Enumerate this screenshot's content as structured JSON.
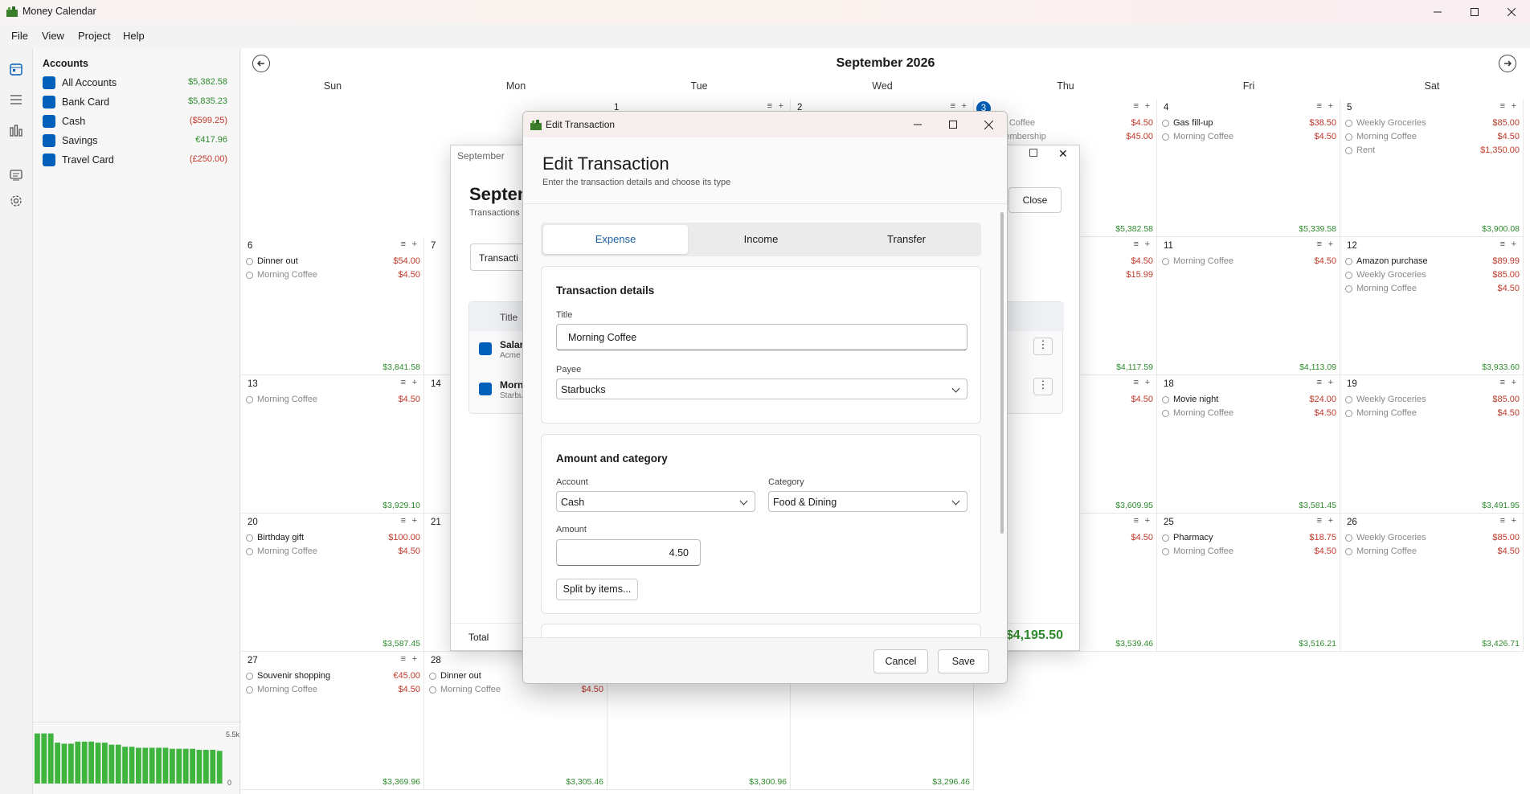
{
  "app": {
    "title": "Money Calendar"
  },
  "menu": [
    "File",
    "View",
    "Project",
    "Help"
  ],
  "accounts": {
    "heading": "Accounts",
    "items": [
      {
        "name": "All Accounts",
        "balance": "$5,382.58",
        "type": "pos"
      },
      {
        "name": "Bank Card",
        "balance": "$5,835.23",
        "type": "pos"
      },
      {
        "name": "Cash",
        "balance": "($599.25)",
        "type": "neg"
      },
      {
        "name": "Savings",
        "balance": "€417.96",
        "type": "pos"
      },
      {
        "name": "Travel Card",
        "balance": "(£250.00)",
        "type": "neg"
      }
    ]
  },
  "sparkline": {
    "max_label": "5.5k",
    "min_label": "0",
    "values": [
      4.9,
      4.9,
      4.9,
      4.0,
      3.9,
      3.9,
      4.1,
      4.1,
      4.1,
      4.0,
      4.0,
      3.8,
      3.8,
      3.6,
      3.6,
      3.5,
      3.5,
      3.5,
      3.5,
      3.5,
      3.4,
      3.4,
      3.4,
      3.4,
      3.3,
      3.3,
      3.3,
      3.2
    ]
  },
  "calendar": {
    "title": "September 2026",
    "days": [
      "Sun",
      "Mon",
      "Tue",
      "Wed",
      "Thu",
      "Fri",
      "Sat"
    ]
  },
  "cells": [
    {
      "day": "1",
      "col": 2,
      "row": 0,
      "total": ""
    },
    {
      "day": "2",
      "col": 3,
      "row": 0,
      "total": ""
    },
    {
      "day": "3",
      "col": 4,
      "row": 0,
      "today": true,
      "total": "$5,382.58",
      "tx": [
        {
          "t": "ning Coffee",
          "a": "$4.50",
          "rec": true
        },
        {
          "t": "n Membership",
          "a": "$45.00",
          "rec": true
        }
      ]
    },
    {
      "day": "4",
      "col": 5,
      "row": 0,
      "total": "$5,339.58",
      "tx": [
        {
          "t": "Gas fill-up",
          "a": "$38.50"
        },
        {
          "t": "Morning Coffee",
          "a": "$4.50",
          "rec": true
        }
      ]
    },
    {
      "day": "5",
      "col": 6,
      "row": 0,
      "total": "$3,900.08",
      "tx": [
        {
          "t": "Weekly Groceries",
          "a": "$85.00",
          "rec": true
        },
        {
          "t": "Morning Coffee",
          "a": "$4.50",
          "rec": true
        },
        {
          "t": "Rent",
          "a": "$1,350.00",
          "rec": true
        }
      ]
    },
    {
      "day": "6",
      "col": 0,
      "row": 1,
      "total": "$3,841.58",
      "tx": [
        {
          "t": "Dinner out",
          "a": "$54.00"
        },
        {
          "t": "Morning Coffee",
          "a": "$4.50",
          "rec": true
        }
      ]
    },
    {
      "day": "7",
      "col": 1,
      "row": 1,
      "total": ""
    },
    {
      "day": "",
      "col": 4,
      "row": 1,
      "total": "$4,117.59",
      "tx": [
        {
          "t": "",
          "a": "$4.50"
        },
        {
          "t": "",
          "a": "$15.99"
        }
      ]
    },
    {
      "day": "11",
      "col": 5,
      "row": 1,
      "total": "$4,113.09",
      "tx": [
        {
          "t": "Morning Coffee",
          "a": "$4.50",
          "rec": true
        }
      ]
    },
    {
      "day": "12",
      "col": 6,
      "row": 1,
      "total": "$3,933.60",
      "tx": [
        {
          "t": "Amazon purchase",
          "a": "$89.99"
        },
        {
          "t": "Weekly Groceries",
          "a": "$85.00",
          "rec": true
        },
        {
          "t": "Morning Coffee",
          "a": "$4.50",
          "rec": true
        }
      ]
    },
    {
      "day": "13",
      "col": 0,
      "row": 2,
      "total": "$3,929.10",
      "tx": [
        {
          "t": "Morning Coffee",
          "a": "$4.50",
          "rec": true
        }
      ]
    },
    {
      "day": "14",
      "col": 1,
      "row": 2,
      "total": ""
    },
    {
      "day": "",
      "col": 4,
      "row": 2,
      "total": "$3,609.95",
      "tx": [
        {
          "t": "",
          "a": "$4.50"
        }
      ]
    },
    {
      "day": "18",
      "col": 5,
      "row": 2,
      "total": "$3,581.45",
      "tx": [
        {
          "t": "Movie night",
          "a": "$24.00"
        },
        {
          "t": "Morning Coffee",
          "a": "$4.50",
          "rec": true
        }
      ]
    },
    {
      "day": "19",
      "col": 6,
      "row": 2,
      "total": "$3,491.95",
      "tx": [
        {
          "t": "Weekly Groceries",
          "a": "$85.00",
          "rec": true
        },
        {
          "t": "Morning Coffee",
          "a": "$4.50",
          "rec": true
        }
      ]
    },
    {
      "day": "20",
      "col": 0,
      "row": 3,
      "total": "$3,587.45",
      "tx": [
        {
          "t": "Birthday gift",
          "a": "$100.00"
        },
        {
          "t": "Morning Coffee",
          "a": "$4.50",
          "rec": true
        }
      ]
    },
    {
      "day": "21",
      "col": 1,
      "row": 3,
      "total": ""
    },
    {
      "day": "",
      "col": 4,
      "row": 3,
      "total": "$3,539.46",
      "tx": [
        {
          "t": "",
          "a": "$4.50"
        }
      ]
    },
    {
      "day": "25",
      "col": 5,
      "row": 3,
      "total": "$3,516.21",
      "tx": [
        {
          "t": "Pharmacy",
          "a": "$18.75"
        },
        {
          "t": "Morning Coffee",
          "a": "$4.50",
          "rec": true
        }
      ]
    },
    {
      "day": "26",
      "col": 6,
      "row": 3,
      "total": "$3,426.71",
      "tx": [
        {
          "t": "Weekly Groceries",
          "a": "$85.00",
          "rec": true
        },
        {
          "t": "Morning Coffee",
          "a": "$4.50",
          "rec": true
        }
      ]
    },
    {
      "day": "27",
      "col": 0,
      "row": 4,
      "total": "$3,369.96",
      "tx": [
        {
          "t": "Souvenir shopping",
          "a": "€45.00"
        },
        {
          "t": "Morning Coffee",
          "a": "$4.50",
          "rec": true
        }
      ]
    },
    {
      "day": "28",
      "col": 1,
      "row": 4,
      "total": "$3,305.46",
      "tx": [
        {
          "t": "Dinner out",
          "a": ""
        },
        {
          "t": "Morning Coffee",
          "a": "$4.50",
          "rec": true
        }
      ]
    },
    {
      "day": "",
      "col": 2,
      "row": 4,
      "total": "$3,300.96"
    },
    {
      "day": "",
      "col": 3,
      "row": 4,
      "total": "$3,296.46"
    }
  ],
  "bg_window": {
    "title": "September",
    "heading": "Septem",
    "sub": "Transactions a",
    "tab": "Transacti",
    "close": "Close",
    "col_title": "Title",
    "row1": {
      "name": "Salary",
      "sub": "Acme"
    },
    "row2": {
      "name": "Morn",
      "sub": "Starbu"
    },
    "total_label": "Total",
    "total_value": "$4,195.50"
  },
  "dialog": {
    "window_title": "Edit Transaction",
    "heading": "Edit Transaction",
    "subheading": "Enter the transaction details and choose its type",
    "tabs": [
      "Expense",
      "Income",
      "Transfer"
    ],
    "details": {
      "heading": "Transaction details",
      "title_label": "Title",
      "title_value": "Morning Coffee",
      "payee_label": "Payee",
      "payee_value": "Starbucks"
    },
    "amount": {
      "heading": "Amount and category",
      "account_label": "Account",
      "account_value": "Cash",
      "category_label": "Category",
      "category_value": "Food & Dining",
      "amount_label": "Amount",
      "amount_value": "4.50",
      "split_label": "Split by items..."
    },
    "cancel": "Cancel",
    "save": "Save"
  }
}
